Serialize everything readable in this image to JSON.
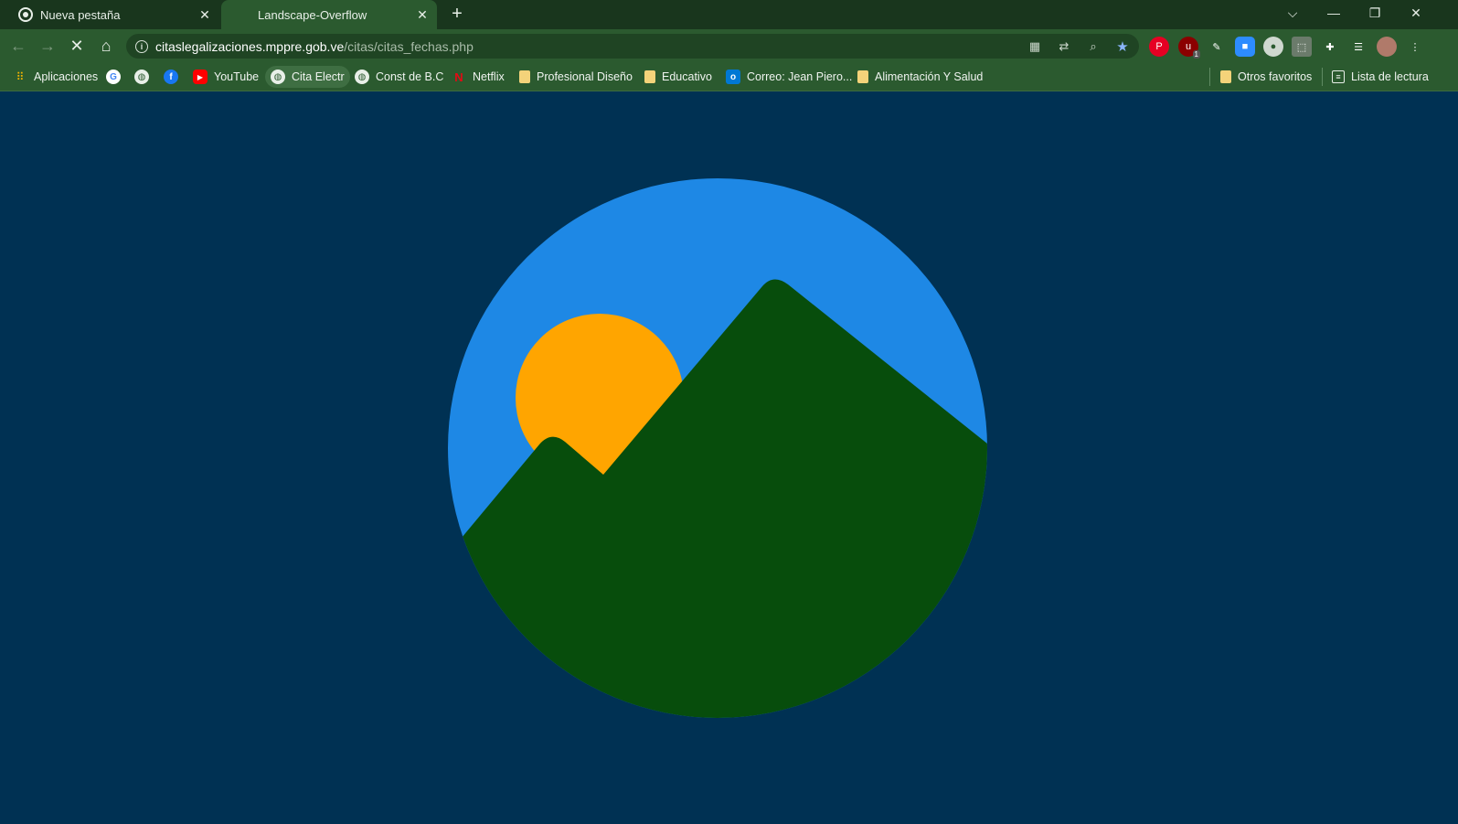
{
  "tabs": [
    {
      "label": "Nueva pestaña",
      "icon": "chrome-icon",
      "active": false
    },
    {
      "label": "Landscape-Overflow",
      "icon": "loading-icon",
      "active": true
    }
  ],
  "address": {
    "host": "citaslegalizaciones.mppre.gob.ve",
    "path": "/citas/citas_fechas.php"
  },
  "bookmarks": [
    {
      "label": "Aplicaciones",
      "icon": "apps-grid-icon"
    },
    {
      "label": "",
      "icon": "google-icon"
    },
    {
      "label": "",
      "icon": "globe-icon"
    },
    {
      "label": "",
      "icon": "facebook-icon"
    },
    {
      "label": "YouTube",
      "icon": "youtube-icon"
    },
    {
      "label": "Cita Electr",
      "icon": "globe-icon"
    },
    {
      "label": "Const de B.C",
      "icon": "globe-icon"
    },
    {
      "label": "Netflix",
      "icon": "netflix-icon"
    },
    {
      "label": "Profesional Diseño",
      "icon": "folder-icon"
    },
    {
      "label": "Educativo",
      "icon": "folder-icon"
    },
    {
      "label": "Correo: Jean Piero...",
      "icon": "outlook-icon"
    },
    {
      "label": "Alimentación Y Salud",
      "icon": "folder-icon"
    }
  ],
  "bookmarks_right": {
    "other": "Otros favoritos",
    "reading_list": "Lista de lectura"
  },
  "extension_badge": "1",
  "colors": {
    "page_bg": "#003153",
    "sky": "#1e88e5",
    "sun": "#ffa500",
    "mountain": "#074d0c",
    "browser_frame": "#2b5a2f"
  }
}
